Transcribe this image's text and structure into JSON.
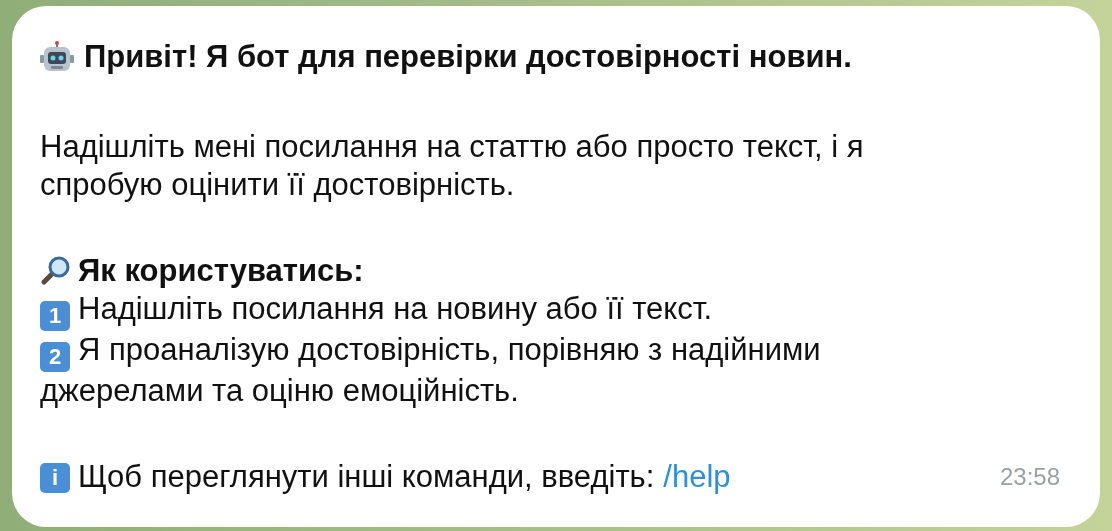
{
  "message": {
    "title": "Привіт! Я бот для перевірки достовірності новин.",
    "intro": "Надішліть мені посилання на статтю або просто текст, і я спробую оцінити її достовірність.",
    "howto": {
      "title": "Як користуватись:",
      "steps": [
        {
          "key": "1",
          "text": "Надішліть посилання на новину або її текст."
        },
        {
          "key": "2",
          "text": "Я проаналізую достовірність, порівняю з надійними джерелами та оціню емоційність."
        }
      ]
    },
    "footer": {
      "key": "i",
      "text": "Щоб переглянути інші команди, введіть:",
      "link": "/help"
    },
    "time": "23:58"
  }
}
